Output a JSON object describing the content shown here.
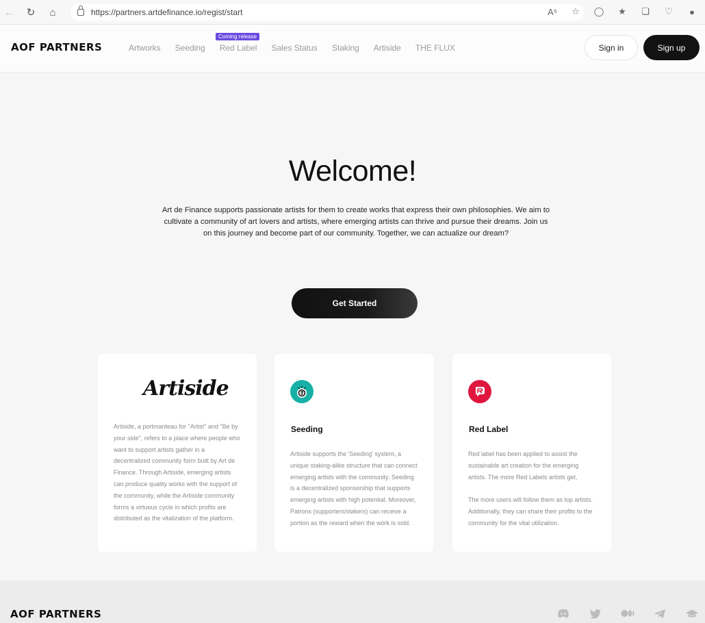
{
  "browser": {
    "url": "https://partners.artdefinance.io/regist/start"
  },
  "header": {
    "logo": "AOF PARTNERS",
    "nav": [
      {
        "label": "Artworks"
      },
      {
        "label": "Seeding"
      },
      {
        "label": "Red Label"
      },
      {
        "label": "Sales Status"
      },
      {
        "label": "Staking"
      },
      {
        "label": "Artiside"
      },
      {
        "label": "THE FLUX"
      }
    ],
    "badge": "Coming release",
    "signin": "Sign in",
    "signup": "Sign up"
  },
  "hero": {
    "title": "Welcome!",
    "description": "Art de Finance supports passionate artists for them to create works that express their own philosophies. We aim to cultivate a community of art lovers and artists, where emerging artists can thrive and pursue their dreams. Join us on this journey and become part of our community. Together, we can actualize our dream?",
    "cta": "Get Started"
  },
  "cards": {
    "artiside": {
      "logo": "Artiside",
      "text": "Artiside, a portmanteau for \"Artist\" and \"Be by your side\", refers to a place where people who want to support artists gather in a decentralized community form built by Art de Finance. Through Artiside, emerging artists can produce quality works with the support of the community, while the Artiside community forms a virtuous cycle in which profits are distributed as the vitalization of the platform."
    },
    "seeding": {
      "title": "Seeding",
      "text": "Artiside supports the 'Seeding' system, a unique staking-alike structure that can connect emerging artists with the community. Seeding is a decentralized sponsorship that supports emerging artists with high potential. Moreover, Patrons (supporters/stakers) can receive a portion as the reward when the work is sold."
    },
    "redlabel": {
      "title": "Red Label",
      "text1": "Red label has been applied to assist the sustainable art creation for the emerging artists. The more Red Labels artists get,",
      "text2": "The more users will follow them as top artists. Additionally, they can share their profits to the community for the vital utilization."
    }
  },
  "footer": {
    "logo": "AOF PARTNERS",
    "socials": [
      "discord-icon",
      "twitter-icon",
      "medium-icon",
      "telegram-icon",
      "gitbook-icon"
    ]
  },
  "colors": {
    "badge": "#6a4ae0",
    "seeding": "#17b0a6",
    "redlabel": "#e0163f",
    "dark": "#121212"
  }
}
